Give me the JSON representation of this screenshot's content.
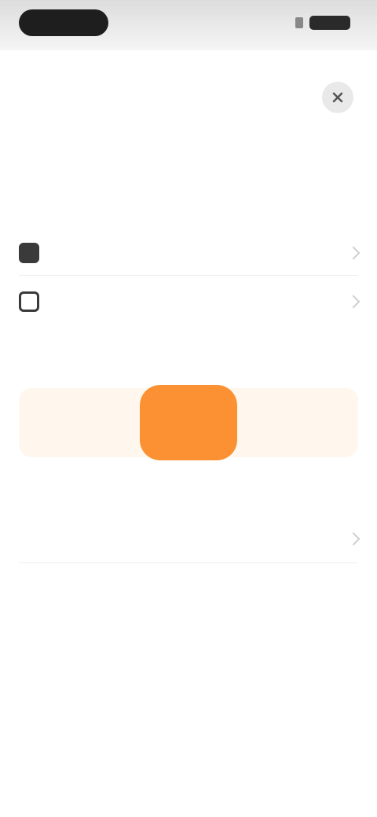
{
  "status_bar": {
    "time": "",
    "icons": [
      "signal-icon",
      "battery-icon"
    ]
  },
  "sheet": {
    "close_icon": "close-icon",
    "title": "",
    "subtitle": "",
    "rows": [
      {
        "icon": "calendar-icon",
        "label": "",
        "value": ""
      },
      {
        "icon": "repeat-icon",
        "label": "",
        "value": ""
      }
    ],
    "section_title_1": "",
    "segments": [
      {
        "label": "",
        "active": false
      },
      {
        "label": "",
        "active": true
      },
      {
        "label": "",
        "active": false
      }
    ],
    "section_title_2": "",
    "list_item": ""
  },
  "colors": {
    "accent": "#fb9132",
    "segment_bg": "#fff7ee"
  }
}
